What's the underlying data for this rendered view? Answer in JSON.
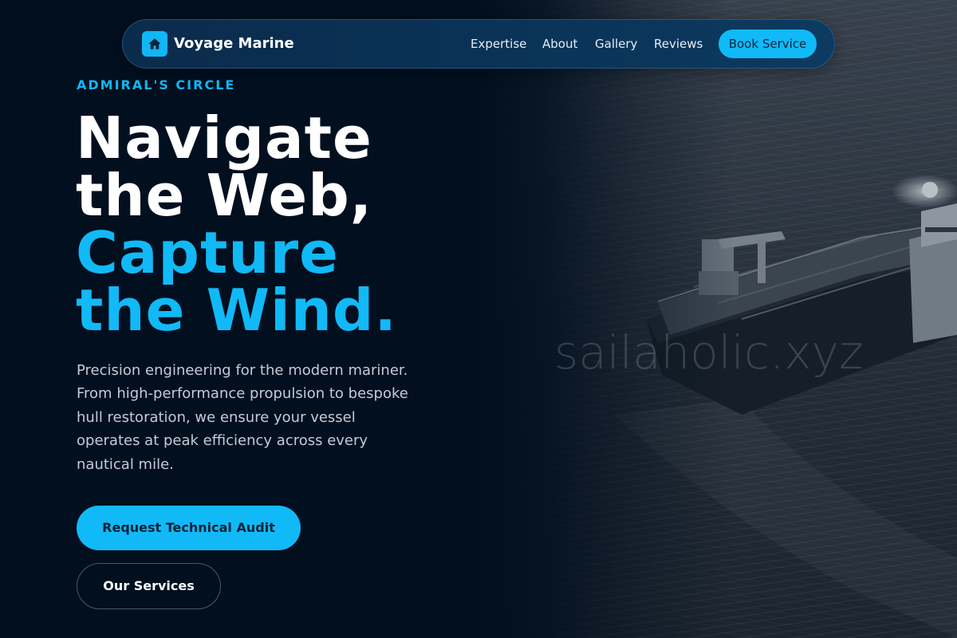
{
  "brand": {
    "name": "Voyage Marine",
    "icon": "home-icon"
  },
  "nav": {
    "links": [
      "Expertise",
      "About",
      "Gallery",
      "Reviews"
    ],
    "cta_label": "Book Service"
  },
  "hero": {
    "eyebrow": "ADMIRAL'S CIRCLE",
    "headline_lines": [
      "Navigate",
      "the Web,",
      "Capture",
      "the Wind."
    ],
    "description": "Precision engineering for the modern mariner. From high-performance propulsion to bespoke hull restoration, we ensure your vessel operates at peak efficiency across every nautical mile.",
    "primary_cta": "Request Technical Audit",
    "secondary_cta": "Our Services",
    "image_watermark": "sailaholic.xyz"
  },
  "colors": {
    "accent": "#11b9f7",
    "background": "#010f1f",
    "nav_background": "#0a3357"
  }
}
